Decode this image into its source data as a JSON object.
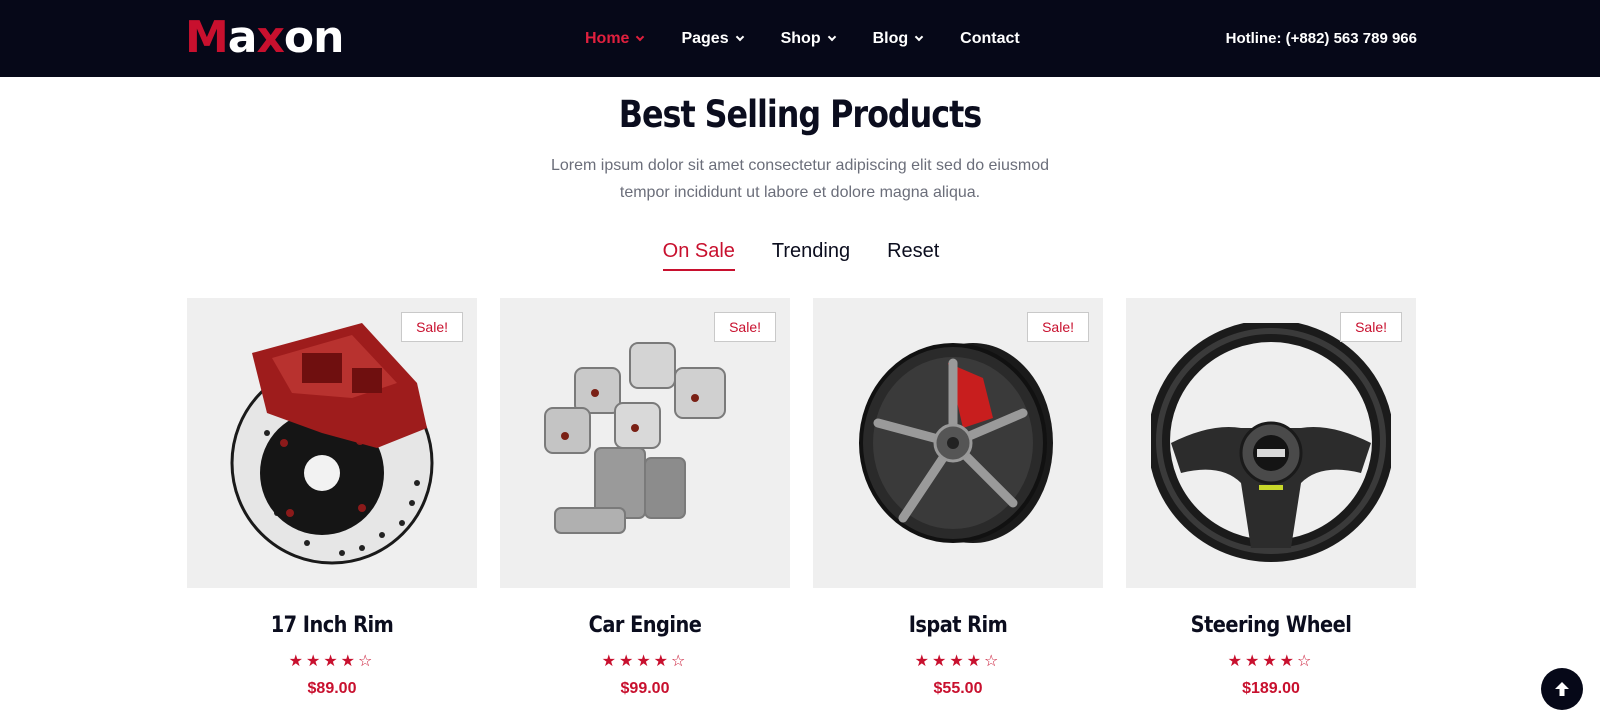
{
  "brand": {
    "logo_parts": [
      "M",
      "a",
      "x",
      "on"
    ]
  },
  "nav": {
    "items": [
      {
        "label": "Home",
        "dropdown": true,
        "active": true
      },
      {
        "label": "Pages",
        "dropdown": true
      },
      {
        "label": "Shop",
        "dropdown": true
      },
      {
        "label": "Blog",
        "dropdown": true
      },
      {
        "label": "Contact",
        "dropdown": false
      }
    ],
    "hotline": "Hotline: (+882) 563 789 966"
  },
  "section": {
    "title": "Best Selling Products",
    "subtitle_line1": "Lorem ipsum dolor sit amet consectetur adipiscing elit sed do eiusmod",
    "subtitle_line2": "tempor incididunt ut labore et dolore magna aliqua."
  },
  "tabs": [
    {
      "label": "On Sale",
      "active": true
    },
    {
      "label": "Trending"
    },
    {
      "label": "Reset"
    }
  ],
  "products": [
    {
      "name": "17 Inch Rim",
      "badge": "Sale!",
      "rating": 4,
      "max_rating": 5,
      "stars": "★★★★☆",
      "price": "$89.00",
      "image_icon": "brake-disc-icon"
    },
    {
      "name": "Car Engine",
      "badge": "Sale!",
      "rating": 4,
      "max_rating": 5,
      "stars": "★★★★☆",
      "price": "$99.00",
      "image_icon": "engine-pistons-icon"
    },
    {
      "name": "Ispat Rim",
      "badge": "Sale!",
      "rating": 4,
      "max_rating": 5,
      "stars": "★★★★☆",
      "price": "$55.00",
      "image_icon": "alloy-rim-icon"
    },
    {
      "name": "Steering Wheel",
      "badge": "Sale!",
      "rating": 4,
      "max_rating": 5,
      "stars": "★★★★☆",
      "price": "$189.00",
      "image_icon": "steering-wheel-icon"
    }
  ],
  "colors": {
    "accent": "#c8102e",
    "header_bg": "#060818",
    "card_bg": "#efefef"
  }
}
